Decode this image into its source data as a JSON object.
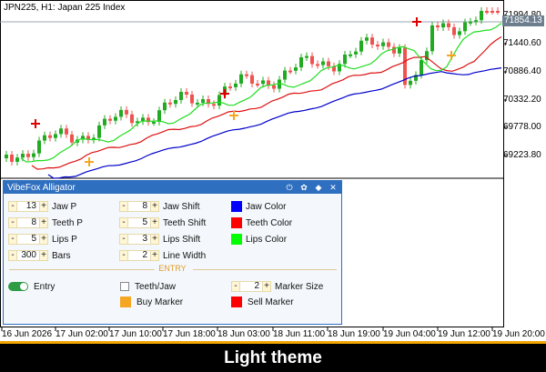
{
  "symbol_label": "JPN225, H1:  Japan 225 Index",
  "price_axis": {
    "labels": [
      "71994.80",
      "71440.60",
      "70886.40",
      "70332.20",
      "69778.00",
      "69223.80"
    ],
    "current_price": "71854.13"
  },
  "time_axis": {
    "labels": [
      "16 Jun 2026",
      "17 Jun 02:00",
      "17 Jun 10:00",
      "17 Jun 18:00",
      "18 Jun 03:00",
      "18 Jun 11:00",
      "18 Jun 19:00",
      "19 Jun 04:00",
      "19 Jun 12:00",
      "19 Jun 20:00"
    ]
  },
  "panel": {
    "title": "VibeFox Alligator",
    "header_icons": [
      "power-icon",
      "gear-icon",
      "pin-icon",
      "close-icon"
    ],
    "jaw_p": {
      "value": "13",
      "label": "Jaw P"
    },
    "teeth_p": {
      "value": "8",
      "label": "Teeth P"
    },
    "lips_p": {
      "value": "5",
      "label": "Lips P"
    },
    "bars": {
      "value": "300",
      "label": "Bars"
    },
    "jaw_shift": {
      "value": "8",
      "label": "Jaw Shift"
    },
    "teeth_shift": {
      "value": "5",
      "label": "Teeth Shift"
    },
    "lips_shift": {
      "value": "3",
      "label": "Lips Shift"
    },
    "line_width": {
      "value": "2",
      "label": "Line Width"
    },
    "jaw_color": {
      "label": "Jaw Color",
      "color": "#0000ff"
    },
    "teeth_color": {
      "label": "Teeth Color",
      "color": "#ff0000"
    },
    "lips_color": {
      "label": "Lips Color",
      "color": "#00ff00"
    },
    "entry_section": "ENTRY",
    "entry": {
      "label": "Entry",
      "enabled": true
    },
    "teeth_jaw": {
      "label": "Teeth/Jaw",
      "checked": false
    },
    "marker_size": {
      "value": "2",
      "label": "Marker Size"
    },
    "buy_marker": {
      "label": "Buy Marker",
      "color": "#f5a623"
    },
    "sell_marker": {
      "label": "Sell Marker",
      "color": "#ff0000"
    },
    "minus": "-",
    "plus": "+"
  },
  "colors": {
    "bull": "#22aa22",
    "bear": "#ef5350",
    "jaw": "#0000cc",
    "teeth": "#dd1111",
    "lips": "#22dd22",
    "buy": "#f5a623",
    "sell": "#dd0000"
  },
  "footer_text": "Light theme"
}
